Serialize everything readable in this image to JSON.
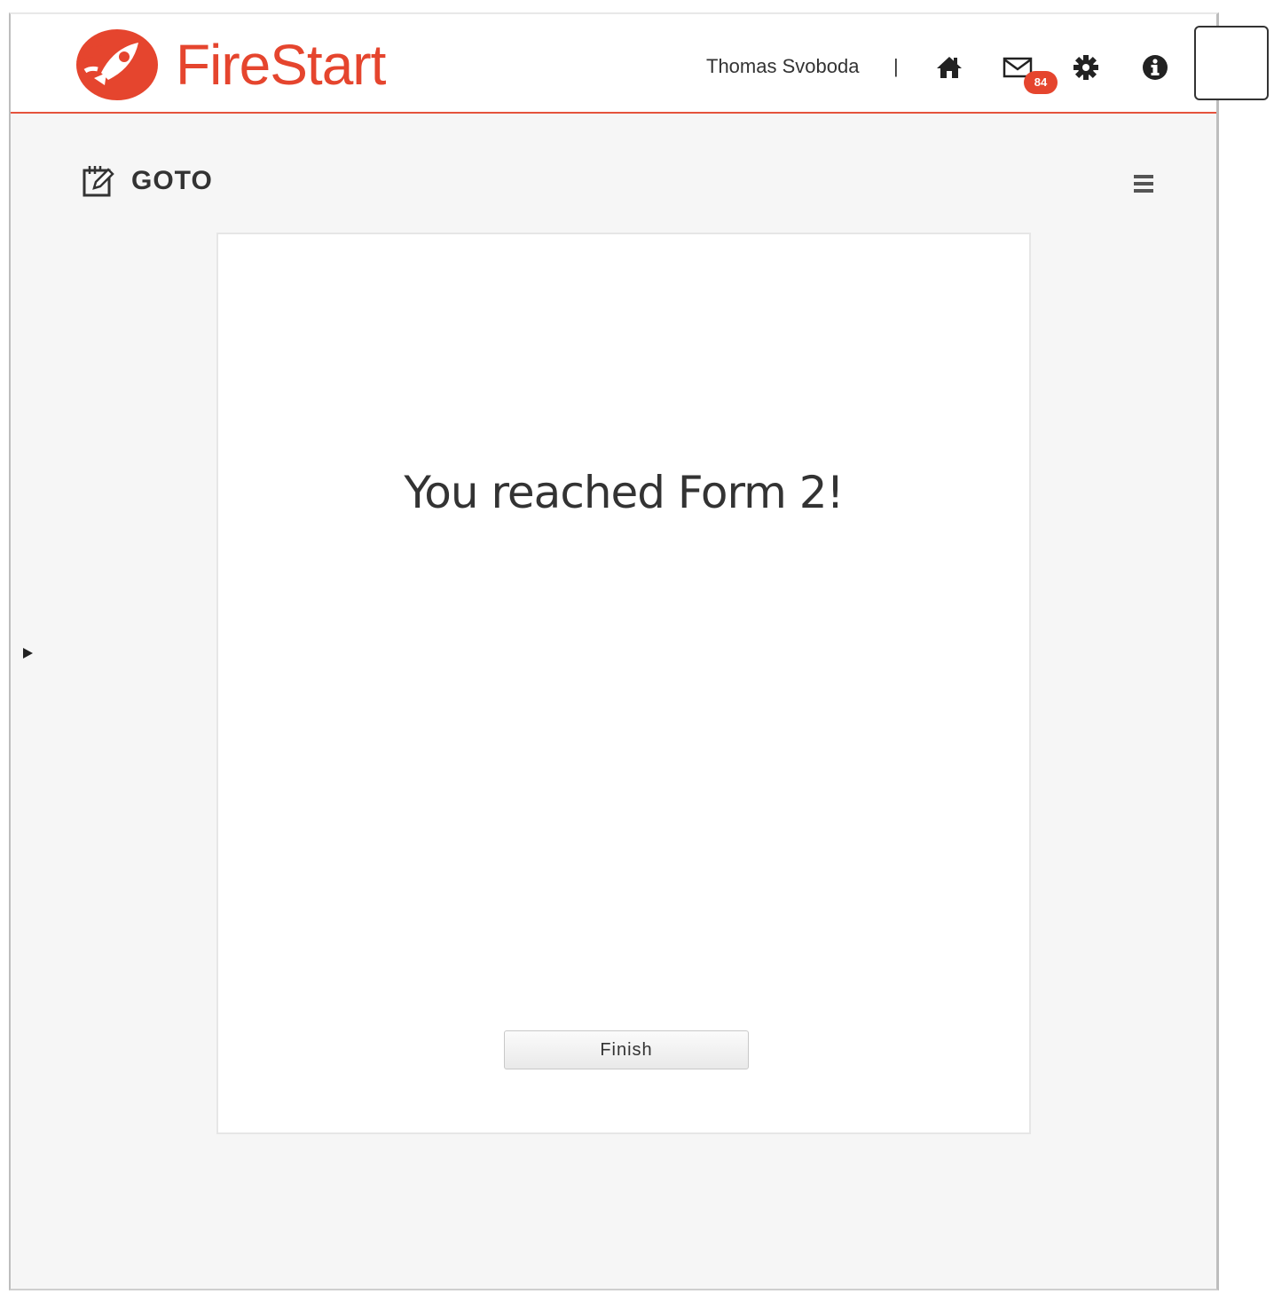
{
  "header": {
    "app_name": "FireStart",
    "user_name": "Thomas Svoboda",
    "divider": "|",
    "mail_badge_count": "84",
    "icons": [
      "home-icon",
      "mail-icon",
      "gear-icon",
      "info-icon"
    ],
    "brand_color": "#e5452e"
  },
  "page": {
    "title": "GOTO",
    "title_icon": "edit-form-icon",
    "menu_icon": "hamburger-menu-icon",
    "sidebar_toggle_icon": "triangle-right-icon"
  },
  "form": {
    "heading": "You reached Form 2!",
    "finish_label": "Finish"
  }
}
